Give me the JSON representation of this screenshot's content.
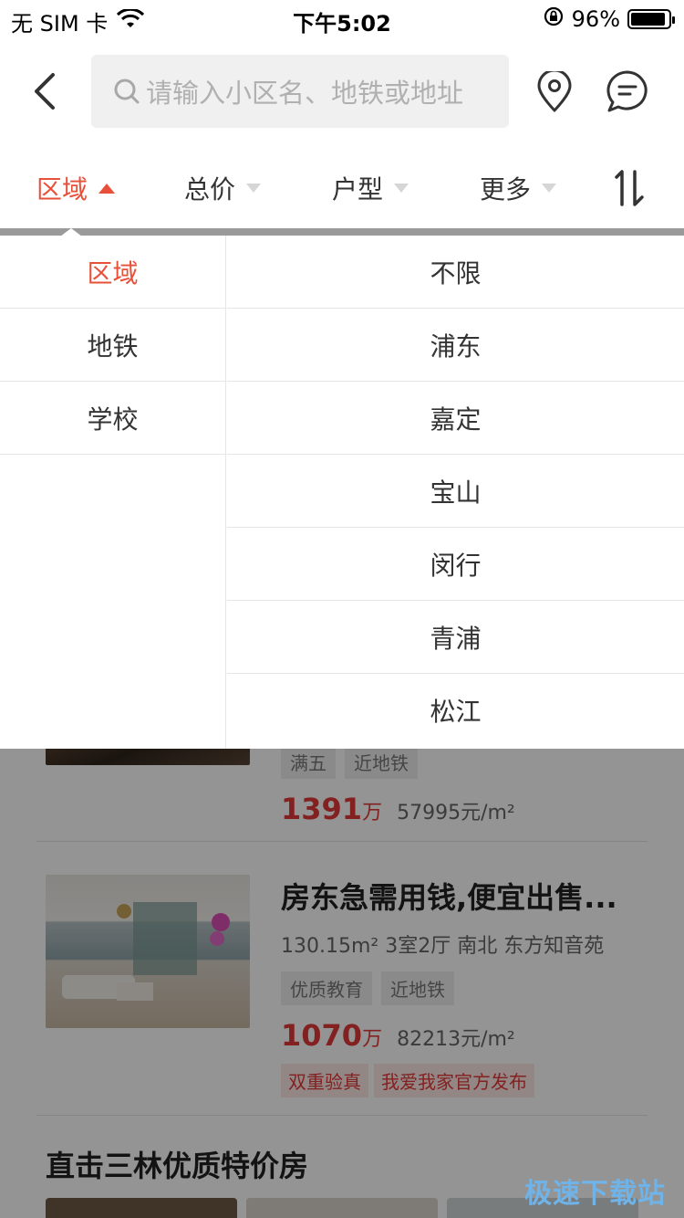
{
  "status_bar": {
    "carrier": "无 SIM 卡",
    "time": "下午5:02",
    "battery": "96%"
  },
  "header": {
    "search_placeholder": "请输入小区名、地铁或地址"
  },
  "filters": [
    {
      "label": "区域",
      "active": true
    },
    {
      "label": "总价",
      "active": false
    },
    {
      "label": "户型",
      "active": false
    },
    {
      "label": "更多",
      "active": false
    }
  ],
  "dropdown": {
    "left": [
      "区域",
      "地铁",
      "学校"
    ],
    "right": [
      "不限",
      "浦东",
      "嘉定",
      "宝山",
      "闵行",
      "青浦",
      "松江"
    ]
  },
  "listings": [
    {
      "tags": [
        "满五",
        "近地铁"
      ],
      "price": "1391",
      "price_unit": "万",
      "unit_price": "57995元/m²"
    },
    {
      "title": "房东急需用钱,便宜出售...",
      "meta": "130.15m²  3室2厅  南北  东方知音苑",
      "tags": [
        "优质教育",
        "近地铁"
      ],
      "price": "1070",
      "price_unit": "万",
      "unit_price": "82213元/m²",
      "badges": [
        "双重验真",
        "我爱我家官方发布"
      ]
    }
  ],
  "section_title": "直击三林优质特价房",
  "watermark": "极速下载站",
  "colors": {
    "accent": "#e8503a",
    "price": "#e23a3a"
  }
}
